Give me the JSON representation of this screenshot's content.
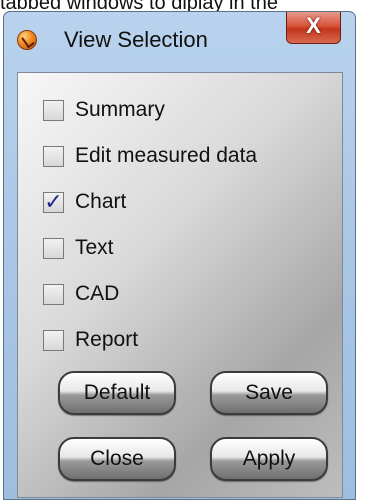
{
  "caption": "tabbed windows to diplay in the",
  "window": {
    "title": "View Selection",
    "icon": "orange-globe-check-icon",
    "close_glyph": "X"
  },
  "checkboxes": [
    {
      "label": "Summary",
      "checked": false
    },
    {
      "label": "Edit measured data",
      "checked": false
    },
    {
      "label": "Chart",
      "checked": true
    },
    {
      "label": "Text",
      "checked": false
    },
    {
      "label": "CAD",
      "checked": false
    },
    {
      "label": "Report",
      "checked": false
    }
  ],
  "check_glyph": "✓",
  "buttons": {
    "default": "Default",
    "save": "Save",
    "close": "Close",
    "apply": "Apply"
  }
}
